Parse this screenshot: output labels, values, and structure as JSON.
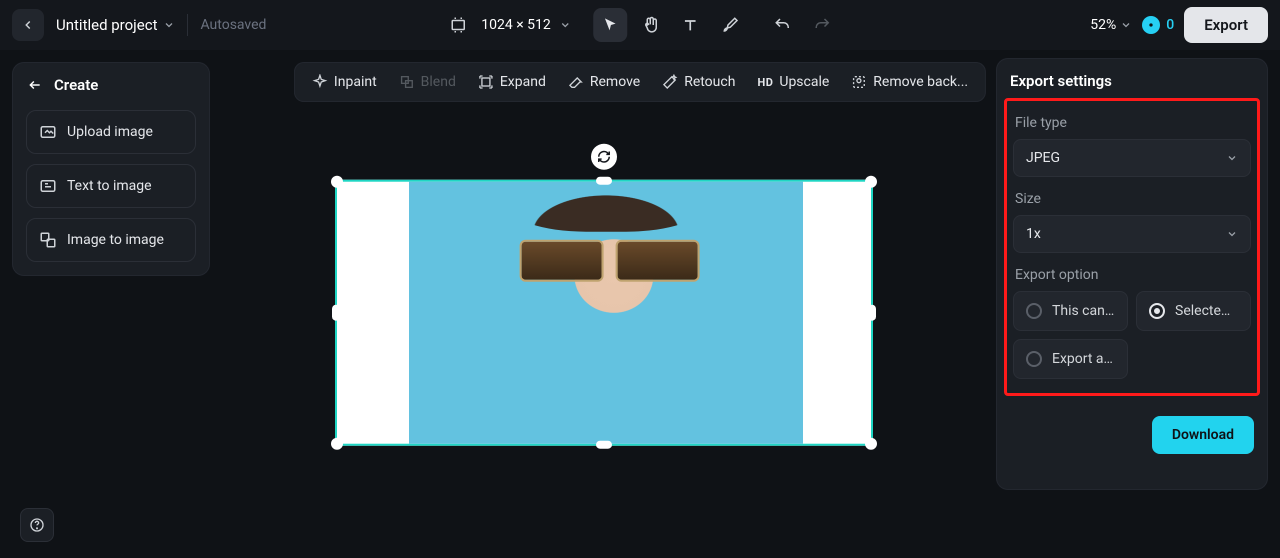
{
  "header": {
    "project_title": "Untitled project",
    "autosaved": "Autosaved",
    "dimensions": "1024 × 512",
    "zoom": "52%",
    "credits": "0",
    "export_label": "Export"
  },
  "left_panel": {
    "create_label": "Create",
    "items": [
      {
        "label": "Upload image"
      },
      {
        "label": "Text to image"
      },
      {
        "label": "Image to image"
      }
    ]
  },
  "toolbar": {
    "items": [
      {
        "label": "Inpaint",
        "disabled": false
      },
      {
        "label": "Blend",
        "disabled": true
      },
      {
        "label": "Expand",
        "disabled": false
      },
      {
        "label": "Remove",
        "disabled": false
      },
      {
        "label": "Retouch",
        "disabled": false
      },
      {
        "label": "Upscale",
        "disabled": false
      },
      {
        "label": "Remove back...",
        "disabled": false
      }
    ]
  },
  "export_panel": {
    "title": "Export settings",
    "file_type_label": "File type",
    "file_type_value": "JPEG",
    "size_label": "Size",
    "size_value": "1x",
    "export_option_label": "Export option",
    "options": {
      "this_canvas": "This canvas",
      "selected": "Selected l...",
      "export_all": "Export all ..."
    },
    "download_label": "Download"
  }
}
